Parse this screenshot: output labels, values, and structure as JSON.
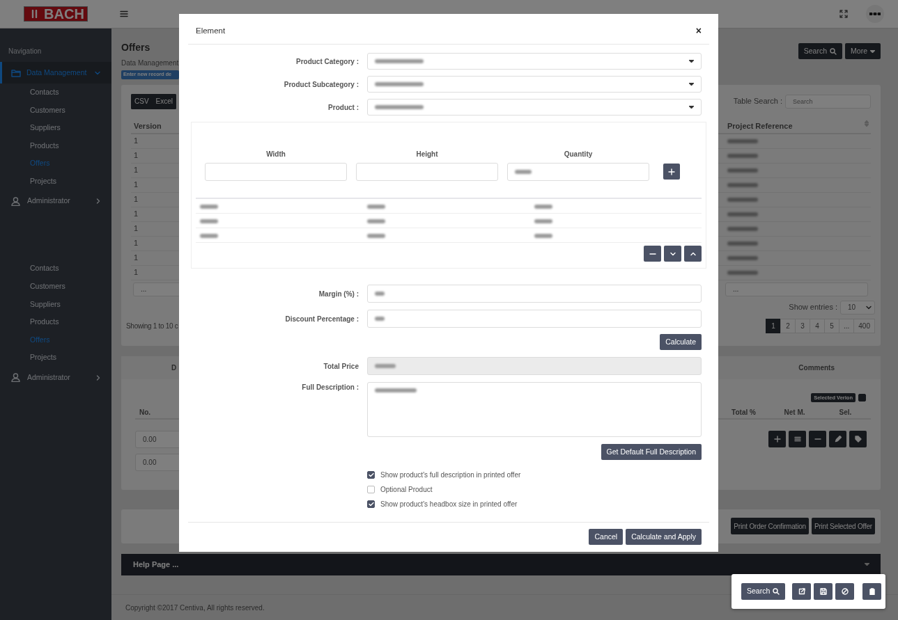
{
  "header": {
    "logo": "BACH"
  },
  "sidebar": {
    "heading": "Navigation",
    "blocks": [
      {
        "items": [
          {
            "label": "Data Management",
            "kind": "group",
            "expanded": true,
            "selected": true
          },
          {
            "label": "Contacts",
            "kind": "link",
            "selected": false
          },
          {
            "label": "Customers",
            "kind": "link",
            "selected": false
          },
          {
            "label": "Suppliers",
            "kind": "link",
            "selected": false
          },
          {
            "label": "Products",
            "kind": "link",
            "selected": false
          },
          {
            "label": "Offers",
            "kind": "link",
            "selected": true
          },
          {
            "label": "Projects",
            "kind": "link",
            "selected": false
          },
          {
            "label": "Administrator",
            "kind": "group",
            "expanded": false,
            "selected": false
          }
        ]
      },
      {
        "items": [
          {
            "label": "Contacts",
            "kind": "link",
            "selected": false
          },
          {
            "label": "Customers",
            "kind": "link",
            "selected": false
          },
          {
            "label": "Suppliers",
            "kind": "link",
            "selected": false
          },
          {
            "label": "Products",
            "kind": "link",
            "selected": false
          },
          {
            "label": "Offers",
            "kind": "link",
            "selected": true
          },
          {
            "label": "Projects",
            "kind": "link",
            "selected": false
          },
          {
            "label": "Administrator",
            "kind": "group",
            "expanded": false,
            "selected": false
          }
        ]
      }
    ]
  },
  "page": {
    "title": "Offers",
    "breadcrumb": "Data Management",
    "badge": "Enter new record de",
    "buttons": [
      {
        "label": "Search",
        "kind": "search"
      },
      {
        "label": "More",
        "kind": "dropdown"
      }
    ]
  },
  "records_table": {
    "export_buttons": [
      "CSV",
      "Excel"
    ],
    "search_label": "Table Search :",
    "search_placeholder": "Search",
    "columns": [
      "Version",
      "Project Reference"
    ],
    "rows": [
      {
        "version": "1",
        "reference_redacted": true
      },
      {
        "version": "1",
        "reference_redacted": true
      },
      {
        "version": "1",
        "reference_redacted": true
      },
      {
        "version": "1",
        "reference_redacted": true
      },
      {
        "version": "1",
        "reference_redacted": true
      },
      {
        "version": "1",
        "reference_redacted": true
      },
      {
        "version": "1",
        "reference_redacted": true
      },
      {
        "version": "1",
        "reference_redacted": true
      },
      {
        "version": "1",
        "reference_redacted": true
      },
      {
        "version": "1",
        "reference_redacted": true
      }
    ],
    "filters": [
      "...",
      "..."
    ],
    "info": "Showing 1 to 10 c",
    "entries_label": "Show entries :",
    "entries_value": "10",
    "pages": [
      {
        "label": "1",
        "selected": true
      },
      {
        "label": "2",
        "selected": false
      },
      {
        "label": "3",
        "selected": false
      },
      {
        "label": "4",
        "selected": false
      },
      {
        "label": "5",
        "selected": false
      },
      {
        "label": "...",
        "selected": false
      },
      {
        "label": "400",
        "selected": false
      }
    ]
  },
  "versions_panel": {
    "tab_left": "D",
    "tab_right": "Comments",
    "selected_version": {
      "label": "Selected Verion",
      "checked": false
    },
    "columns": [
      "No.",
      "Total %",
      "Net M.",
      "Sel."
    ],
    "inputs": [
      "0.00",
      "0.00"
    ],
    "action_buttons": [
      {
        "kind": "add"
      },
      {
        "kind": "list"
      },
      {
        "kind": "remove"
      },
      {
        "kind": "edit"
      },
      {
        "kind": "tag"
      }
    ]
  },
  "print_buttons": [
    "Print Order Confirmation",
    "Print Selected Offer"
  ],
  "help": {
    "label": "Help Page ..."
  },
  "footer": "Copyright ©2017 Centiva, All rights reserved.",
  "floating_toolbar": {
    "search_label": "Search",
    "buttons": [
      {
        "kind": "open"
      },
      {
        "kind": "save"
      },
      {
        "kind": "cancel"
      },
      {
        "kind": "clipboard"
      }
    ]
  },
  "modal": {
    "title": "Element",
    "close": "×",
    "selects": [
      {
        "label": "Product Category :",
        "value_redacted": true
      },
      {
        "label": "Product Subcategory :",
        "value_redacted": true
      },
      {
        "label": "Product :",
        "value_redacted": true
      }
    ],
    "dimensions": {
      "columns": [
        "Width",
        "Height",
        "Quantity"
      ],
      "inputs": [
        {
          "value_redacted": false
        },
        {
          "value_redacted": false
        },
        {
          "value_redacted": true
        }
      ],
      "rows": [
        {
          "width_redacted": true,
          "height_redacted": true,
          "quantity_redacted": true
        },
        {
          "width_redacted": true,
          "height_redacted": true,
          "quantity_redacted": true
        },
        {
          "width_redacted": true,
          "height_redacted": true,
          "quantity_redacted": true
        }
      ],
      "row_buttons": [
        {
          "kind": "remove"
        },
        {
          "kind": "down"
        },
        {
          "kind": "up"
        }
      ]
    },
    "inputs": [
      {
        "label": "Margin (%) :",
        "value_redacted": true
      },
      {
        "label": "Discount Percentage :",
        "value_redacted": true
      }
    ],
    "calculate": "Calculate",
    "total": {
      "label": "Total Price",
      "value_redacted": true,
      "disabled": true
    },
    "description": {
      "label": "Full Description :",
      "value_redacted": true
    },
    "default_button": "Get Default Full Description",
    "options": [
      {
        "label": "Show product's full description in printed offer",
        "checked": true
      },
      {
        "label": "Optional Product",
        "checked": false
      },
      {
        "label": "Show product's headbox size in printed offer",
        "checked": true
      }
    ],
    "footer_buttons": [
      "Cancel",
      "Calculate and Apply"
    ]
  }
}
